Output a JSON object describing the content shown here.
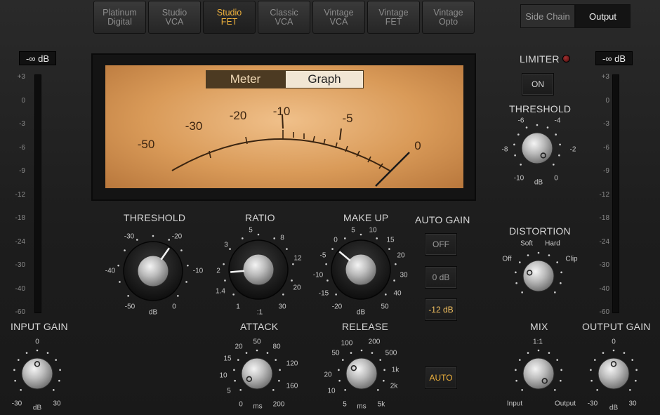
{
  "model_tabs": [
    {
      "label": "Platinum\nDigital",
      "active": false
    },
    {
      "label": "Studio\nVCA",
      "active": false
    },
    {
      "label": "Studio\nFET",
      "active": true
    },
    {
      "label": "Classic\nVCA",
      "active": false
    },
    {
      "label": "Vintage\nVCA",
      "active": false
    },
    {
      "label": "Vintage\nFET",
      "active": false
    },
    {
      "label": "Vintage\nOpto",
      "active": false
    }
  ],
  "routing": {
    "side_chain": "Side Chain",
    "output": "Output"
  },
  "input_meter": {
    "readout": "-∞ dB",
    "scale": [
      "+3",
      "0",
      "-3",
      "-6",
      "-9",
      "-12",
      "-18",
      "-24",
      "-30",
      "-40",
      "-60"
    ]
  },
  "output_meter": {
    "readout": "-∞ dB",
    "scale": [
      "+3",
      "0",
      "-3",
      "-6",
      "-9",
      "-12",
      "-18",
      "-24",
      "-30",
      "-40",
      "-60"
    ]
  },
  "vu": {
    "meter_label": "Meter",
    "graph_label": "Graph",
    "scale": [
      "-50",
      "-30",
      "-20",
      "-10",
      "-5",
      "0"
    ]
  },
  "threshold": {
    "label": "THRESHOLD",
    "ticks": [
      "-30",
      "-20",
      "-40",
      "-10",
      "-50",
      "0"
    ],
    "unit": "dB"
  },
  "ratio": {
    "label": "RATIO",
    "ticks": [
      "5",
      "3",
      "8",
      "2",
      "12",
      "1.4",
      "20",
      "1",
      "30"
    ],
    "unit": ":1"
  },
  "makeup": {
    "label": "MAKE UP",
    "ticks": [
      "0",
      "5",
      "10",
      "-5",
      "15",
      "20",
      "-10",
      "30",
      "-15",
      "40",
      "-20",
      "50"
    ],
    "unit": "dB"
  },
  "auto_gain": {
    "label": "AUTO GAIN",
    "options": [
      "OFF",
      "0 dB",
      "-12 dB"
    ],
    "selected": "-12 dB"
  },
  "attack": {
    "label": "ATTACK",
    "ticks": [
      "50",
      "20",
      "80",
      "15",
      "120",
      "10",
      "5",
      "160",
      "0",
      "200"
    ],
    "unit": "ms"
  },
  "release": {
    "label": "RELEASE",
    "ticks": [
      "100",
      "200",
      "50",
      "500",
      "1k",
      "20",
      "2k",
      "10",
      "5",
      "5k"
    ],
    "unit": "ms"
  },
  "auto_button": {
    "label": "AUTO"
  },
  "limiter": {
    "label": "LIMITER",
    "on_label": "ON",
    "threshold_label": "THRESHOLD",
    "ticks": [
      "-6",
      "-4",
      "-8",
      "-2",
      "-10",
      "0"
    ],
    "unit": "dB"
  },
  "distortion": {
    "label": "DISTORTION",
    "ticks": [
      "Soft",
      "Hard",
      "Off",
      "Clip"
    ]
  },
  "mix": {
    "label": "MIX",
    "ticks": [
      "1:1",
      "Input",
      "Output"
    ]
  },
  "input_gain": {
    "label": "INPUT GAIN",
    "ticks": [
      "0",
      "-30",
      "30"
    ],
    "unit": "dB"
  },
  "output_gain": {
    "label": "OUTPUT GAIN",
    "ticks": [
      "0",
      "-30",
      "30"
    ],
    "unit": "dB"
  },
  "colors": {
    "accent": "#f0b23c",
    "vu_face": "#e0a868",
    "background": "#1e1e1e"
  }
}
